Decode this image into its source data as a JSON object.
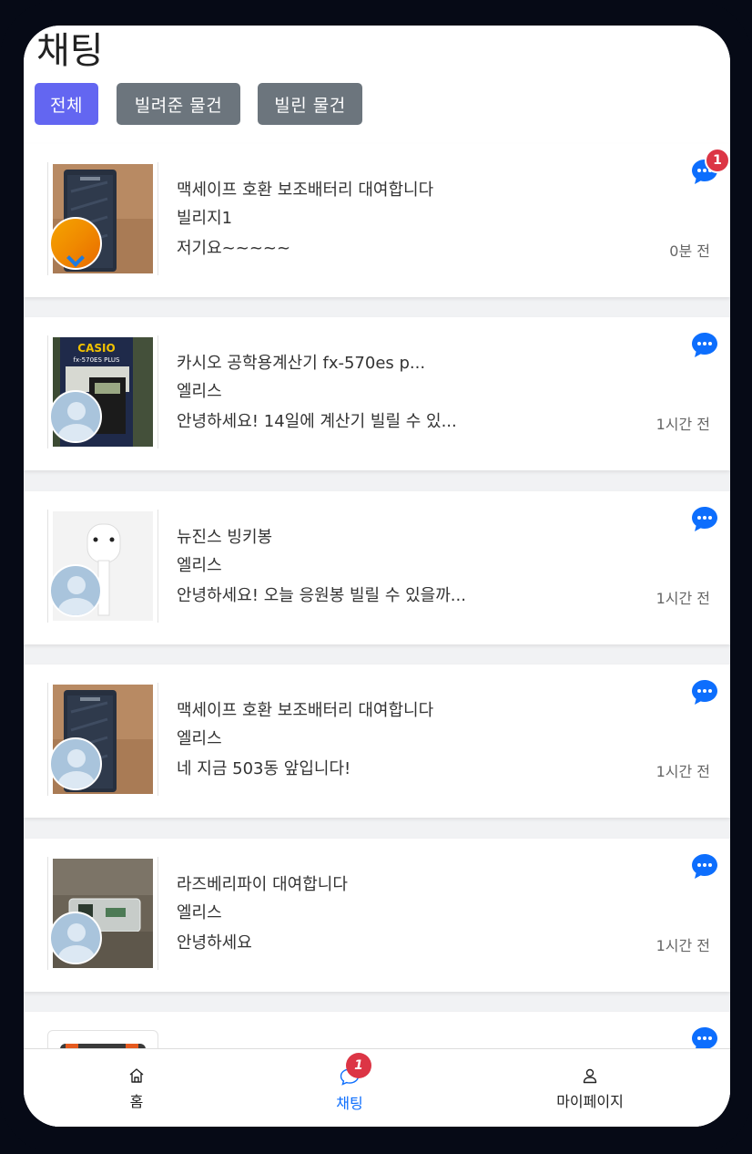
{
  "header": {
    "title": "채팅",
    "filters": [
      "전체",
      "빌려준 물건",
      "빌린 물건"
    ],
    "active_filter": "전체"
  },
  "chats": [
    {
      "title": "맥세이프 호환 보조배터리 대여합니다",
      "user": "빌리지1",
      "message": "저기요~~~~~",
      "time": "0분 전",
      "unread": "1",
      "thumb": "battery",
      "avatar": "orange"
    },
    {
      "title": "카시오 공학용계산기 fx-570es p...",
      "user": "엘리스",
      "message": "안녕하세요! 14일에 계산기 빌릴 수 있...",
      "time": "1시간 전",
      "unread": "",
      "thumb": "calculator",
      "avatar": "default"
    },
    {
      "title": "뉴진스 빙키봉",
      "user": "엘리스",
      "message": "안녕하세요! 오늘 응원봉 빌릴 수 있을까...",
      "time": "1시간 전",
      "unread": "",
      "thumb": "lightstick",
      "avatar": "default"
    },
    {
      "title": "맥세이프 호환 보조배터리 대여합니다",
      "user": "엘리스",
      "message": "네 지금 503동 앞입니다!",
      "time": "1시간 전",
      "unread": "",
      "thumb": "battery",
      "avatar": "default"
    },
    {
      "title": "라즈베리파이 대여합니다",
      "user": "엘리스",
      "message": "안녕하세요",
      "time": "1시간 전",
      "unread": "",
      "thumb": "raspberry",
      "avatar": "default"
    },
    {
      "title": "",
      "user": "",
      "message": "",
      "time": "",
      "unread": "",
      "thumb": "partial",
      "avatar": "none"
    }
  ],
  "thumb_labels": {
    "casio_brand": "CASIO",
    "casio_model": "fx-570ES PLUS"
  },
  "nav": {
    "items": [
      {
        "label": "홈",
        "icon": "home-icon"
      },
      {
        "label": "채팅",
        "icon": "chat-icon",
        "badge": "1",
        "active": true
      },
      {
        "label": "마이페이지",
        "icon": "person-icon"
      }
    ]
  },
  "colors": {
    "primary": "#6366f1",
    "secondary": "#6c757d",
    "chat_blue": "#0d6efd",
    "badge_red": "#dc3545"
  }
}
